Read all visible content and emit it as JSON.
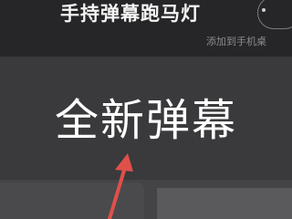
{
  "header": {
    "title": "手持弹幕跑马灯",
    "add_to_home": "添加到手机桌"
  },
  "main": {
    "headline": "全新弹幕"
  },
  "colors": {
    "annotation_arrow": "#e0504a"
  },
  "icons": {
    "more_button": "more-dot-icon",
    "annotation": "red-arrow-icon"
  }
}
